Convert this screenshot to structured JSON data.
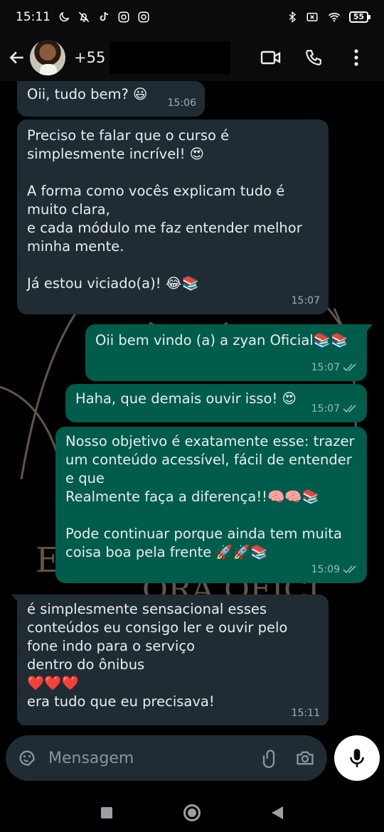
{
  "status_bar": {
    "time": "15:11",
    "battery": "55",
    "left_icons": [
      "moon-icon",
      "muted-bell-icon",
      "tiktok-icon",
      "instagram-icon",
      "instagram-icon"
    ],
    "right_icons": [
      "bluetooth-icon",
      "sim-off-icon",
      "wifi-icon",
      "battery-icon"
    ]
  },
  "header": {
    "contact_name": "+55"
  },
  "messages": [
    {
      "direction": "in",
      "text": "Oii, tudo bem? 😃",
      "time": "15:06"
    },
    {
      "direction": "in",
      "text": "Preciso te falar que o curso é\nsimplesmente incrível! 😍\n\nA forma como vocês explicam tudo é\nmuito clara,\ne cada módulo me faz entender melhor\nminha mente.\n\nJá estou viciado(a)! 😂📚",
      "time": "15:07"
    },
    {
      "direction": "out",
      "text": "Oii bem vindo (a) a zyan Oficial📚📚",
      "time": "15:07"
    },
    {
      "direction": "out",
      "text": "Haha, que demais ouvir isso! 😍",
      "time": "15:07"
    },
    {
      "direction": "out",
      "text": "Nosso objetivo é exatamente esse: trazer\num conteúdo acessível, fácil de entender\ne que\nRealmente faça a diferença!!🧠🧠📚\n\nPode continuar porque ainda tem muita\ncoisa boa pela frente 🚀🚀📚",
      "time": "15:09"
    },
    {
      "direction": "in",
      "text": "é simplesmente sensacional esses\nconteúdos eu consigo ler e ouvir pelo\nfone indo para o serviço\ndentro do ônibus\n❤️❤️❤️\nera tudo que eu precisava!",
      "time": "15:11"
    }
  ],
  "input": {
    "placeholder": "Mensagem"
  },
  "colors": {
    "incoming_bubble": "#1f2c34",
    "outgoing_bubble": "#005c4b",
    "background": "#000000"
  }
}
